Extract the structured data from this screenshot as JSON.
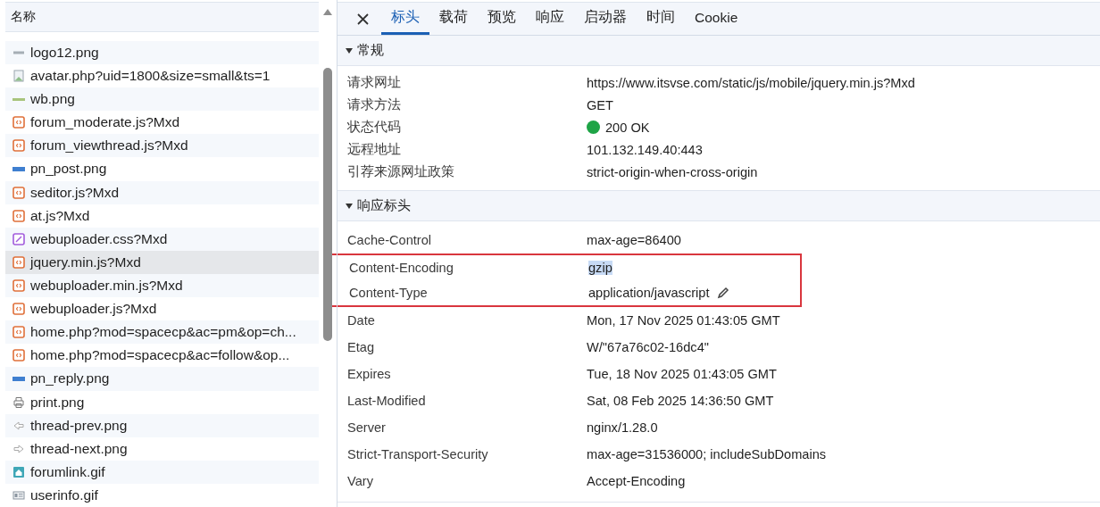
{
  "file_list": {
    "header": "名称",
    "items": [
      {
        "name": "logo12.png",
        "kind": "logo",
        "selected": false
      },
      {
        "name": "avatar.php?uid=1800&size=small&ts=1",
        "kind": "image",
        "selected": false
      },
      {
        "name": "wb.png",
        "kind": "line",
        "selected": false
      },
      {
        "name": "forum_moderate.js?Mxd",
        "kind": "js",
        "selected": false
      },
      {
        "name": "forum_viewthread.js?Mxd",
        "kind": "js",
        "selected": false
      },
      {
        "name": "pn_post.png",
        "kind": "bar",
        "selected": false
      },
      {
        "name": "seditor.js?Mxd",
        "kind": "js",
        "selected": false
      },
      {
        "name": "at.js?Mxd",
        "kind": "js",
        "selected": false
      },
      {
        "name": "webuploader.css?Mxd",
        "kind": "css",
        "selected": false
      },
      {
        "name": "jquery.min.js?Mxd",
        "kind": "js",
        "selected": true
      },
      {
        "name": "webuploader.min.js?Mxd",
        "kind": "js",
        "selected": false
      },
      {
        "name": "webuploader.js?Mxd",
        "kind": "js",
        "selected": false
      },
      {
        "name": "home.php?mod=spacecp&ac=pm&op=ch...",
        "kind": "js",
        "selected": false
      },
      {
        "name": "home.php?mod=spacecp&ac=follow&op...",
        "kind": "js",
        "selected": false
      },
      {
        "name": "pn_reply.png",
        "kind": "bar",
        "selected": false
      },
      {
        "name": "print.png",
        "kind": "print",
        "selected": false
      },
      {
        "name": "thread-prev.png",
        "kind": "prev",
        "selected": false
      },
      {
        "name": "thread-next.png",
        "kind": "next",
        "selected": false
      },
      {
        "name": "forumlink.gif",
        "kind": "home",
        "selected": false
      },
      {
        "name": "userinfo.gif",
        "kind": "card",
        "selected": false
      }
    ]
  },
  "tabs": [
    {
      "label": "标头",
      "selected": true
    },
    {
      "label": "载荷",
      "selected": false
    },
    {
      "label": "预览",
      "selected": false
    },
    {
      "label": "响应",
      "selected": false
    },
    {
      "label": "启动器",
      "selected": false
    },
    {
      "label": "时间",
      "selected": false
    },
    {
      "label": "Cookie",
      "selected": false
    }
  ],
  "sections": [
    {
      "title": "常规",
      "expanded": true,
      "rows": [
        {
          "name": "请求网址",
          "value": "https://www.itsvse.com/static/js/mobile/jquery.min.js?Mxd"
        },
        {
          "name": "请求方法",
          "value": "GET"
        },
        {
          "name": "状态代码",
          "value": "200 OK",
          "color": "#1ea446"
        },
        {
          "name": "远程地址",
          "value": "101.132.149.40:443"
        },
        {
          "name": "引荐来源网址政策",
          "value": "strict-origin-when-cross-origin"
        }
      ]
    },
    {
      "title": "响应标头",
      "expanded": true,
      "rows": [
        {
          "name": "Cache-Control",
          "value": "max-age=86400",
          "highlighted": false
        },
        {
          "name": "Content-Encoding",
          "value": "gzip",
          "highlighted": true,
          "value_selected": true
        },
        {
          "name": "Content-Type",
          "value": "application/javascript",
          "highlighted": true,
          "editable": true
        },
        {
          "name": "Date",
          "value": "Mon, 17 Nov 2025 01:43:05 GMT",
          "highlighted": false
        },
        {
          "name": "Etag",
          "value": "W/\"67a76c02-16dc4\"",
          "highlighted": false
        },
        {
          "name": "Expires",
          "value": "Tue, 18 Nov 2025 01:43:05 GMT",
          "highlighted": false
        },
        {
          "name": "Last-Modified",
          "value": "Sat, 08 Feb 2025 14:36:50 GMT",
          "highlighted": false
        },
        {
          "name": "Server",
          "value": "nginx/1.28.0",
          "highlighted": false
        },
        {
          "name": "Strict-Transport-Security",
          "value": "max-age=31536000; includeSubDomains",
          "highlighted": false
        },
        {
          "name": "Vary",
          "value": "Accept-Encoding",
          "highlighted": false
        }
      ]
    }
  ]
}
